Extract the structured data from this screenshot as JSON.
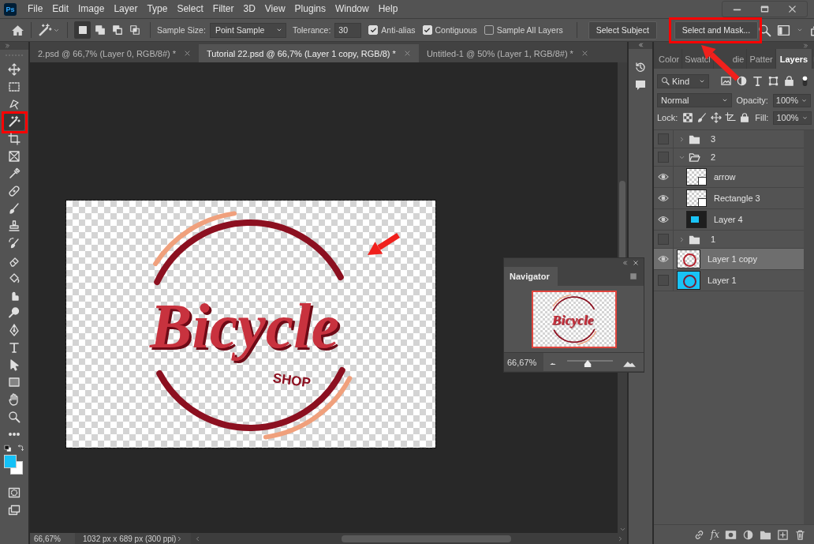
{
  "app": {
    "logo": "Ps"
  },
  "menu": [
    "File",
    "Edit",
    "Image",
    "Layer",
    "Type",
    "Select",
    "Filter",
    "3D",
    "View",
    "Plugins",
    "Window",
    "Help"
  ],
  "options_bar": {
    "selection_modes": [
      {
        "kind": "new",
        "selected": true
      },
      {
        "kind": "add",
        "selected": false
      },
      {
        "kind": "subtract",
        "selected": false
      },
      {
        "kind": "intersect",
        "selected": false
      }
    ],
    "sample_size": {
      "label": "Sample Size:",
      "value": "Point Sample"
    },
    "tolerance": {
      "label": "Tolerance:",
      "value": "30"
    },
    "checkboxes": [
      {
        "label": "Anti-alias",
        "checked": true
      },
      {
        "label": "Contiguous",
        "checked": true
      },
      {
        "label": "Sample All Layers",
        "checked": false
      }
    ],
    "buttons": [
      {
        "label": "Select Subject",
        "highlighted": false
      },
      {
        "label": "Select and Mask...",
        "highlighted": true
      }
    ]
  },
  "tools": [
    {
      "kind": "move",
      "selected": false,
      "highlighted": false
    },
    {
      "kind": "marquee",
      "selected": false,
      "highlighted": false
    },
    {
      "kind": "lasso",
      "selected": false,
      "highlighted": false
    },
    {
      "kind": "wand",
      "selected": true,
      "highlighted": true
    },
    {
      "kind": "crop",
      "selected": false,
      "highlighted": false
    },
    {
      "kind": "frame",
      "selected": false,
      "highlighted": false
    },
    {
      "kind": "eyedropper",
      "selected": false,
      "highlighted": false
    },
    {
      "kind": "healing",
      "selected": false,
      "highlighted": false
    },
    {
      "kind": "brush",
      "selected": false,
      "highlighted": false
    },
    {
      "kind": "stamp",
      "selected": false,
      "highlighted": false
    },
    {
      "kind": "history",
      "selected": false,
      "highlighted": false
    },
    {
      "kind": "eraser",
      "selected": false,
      "highlighted": false
    },
    {
      "kind": "bucket",
      "selected": false,
      "highlighted": false
    },
    {
      "kind": "smudge",
      "selected": false,
      "highlighted": false
    },
    {
      "kind": "dodge",
      "selected": false,
      "highlighted": false
    },
    {
      "kind": "pen",
      "selected": false,
      "highlighted": false
    },
    {
      "kind": "type",
      "selected": false,
      "highlighted": false
    },
    {
      "kind": "path",
      "selected": false,
      "highlighted": false
    },
    {
      "kind": "rectangle",
      "selected": false,
      "highlighted": false
    },
    {
      "kind": "hand",
      "selected": false,
      "highlighted": false
    },
    {
      "kind": "zoom",
      "selected": false,
      "highlighted": false
    },
    {
      "kind": "more",
      "selected": false,
      "highlighted": false
    }
  ],
  "document_tabs": [
    {
      "label": "2.psd @ 66,7% (Layer 0, RGB/8#) *",
      "selected": false
    },
    {
      "label": "Tutorial 22.psd @ 66,7% (Layer 1 copy, RGB/8) *",
      "selected": true
    },
    {
      "label": "Untitled-1 @ 50% (Layer 1, RGB/8#) *",
      "selected": false
    }
  ],
  "canvas": {
    "title": "Bicycle",
    "subtitle": "SHOP"
  },
  "navigator": {
    "title": "Navigator",
    "thumbnail_text": "Bicycle",
    "zoom": "66,67%",
    "level": 0.45
  },
  "status_bar": {
    "zoom": "66,67%",
    "info": "1032 px x 689 px (300 ppi)"
  },
  "panel_tabs": [
    {
      "label": "Color",
      "selected": false
    },
    {
      "label": "Swatcl",
      "selected": false
    },
    {
      "label": [
        "die"
      ],
      "selected": false
    },
    {
      "label": "Patter",
      "selected": false
    },
    {
      "label": "Layers",
      "selected": true
    }
  ],
  "layers_panel": {
    "filter": "Kind",
    "blend_mode": "Normal",
    "opacity_label": "Opacity:",
    "opacity": "100%",
    "lock_label": "Lock:",
    "fill_label": "Fill:",
    "fill": "100%",
    "layers": [
      {
        "name": "3",
        "kind": "group",
        "visible": false,
        "expanded": false,
        "selected": false
      },
      {
        "name": "2",
        "kind": "group",
        "visible": false,
        "expanded": true,
        "selected": false,
        "children": [
          {
            "name": "arrow",
            "kind": "smart",
            "visible": true,
            "selected": false
          },
          {
            "name": "Rectangle 3",
            "kind": "shape",
            "visible": true,
            "selected": false
          },
          {
            "name": "Layer 4",
            "kind": "screen",
            "visible": true,
            "selected": false
          }
        ]
      },
      {
        "name": "1",
        "kind": "group",
        "visible": false,
        "expanded": false,
        "selected": false
      },
      {
        "name": "Layer 1 copy",
        "kind": "logo",
        "visible": true,
        "selected": true
      },
      {
        "name": "Layer 1",
        "kind": "fill",
        "visible": false,
        "selected": false
      }
    ],
    "effects_button": "fx"
  }
}
